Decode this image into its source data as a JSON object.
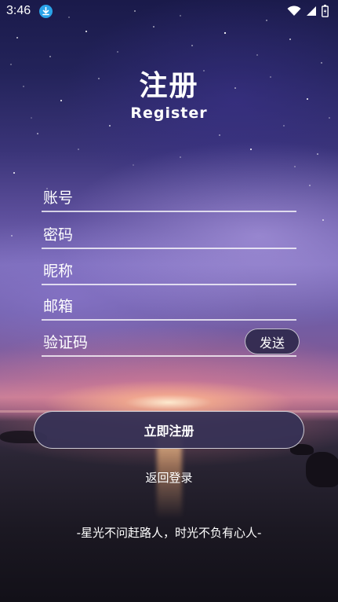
{
  "status_bar": {
    "time": "3:46",
    "icons": [
      "download-icon",
      "wifi-icon",
      "signal-icon",
      "battery-icon"
    ]
  },
  "header": {
    "title": "注册",
    "subtitle": "Register"
  },
  "form": {
    "account_placeholder": "账号",
    "password_placeholder": "密码",
    "nickname_placeholder": "昵称",
    "email_placeholder": "邮箱",
    "code_placeholder": "验证码",
    "send_label": "发送"
  },
  "actions": {
    "register_label": "立即注册",
    "back_login_label": "返回登录"
  },
  "footer": {
    "slogan": "-星光不问赶路人，时光不负有心人-"
  },
  "colors": {
    "accent_button": "#37325a",
    "download_badge": "#2aa3e8"
  }
}
